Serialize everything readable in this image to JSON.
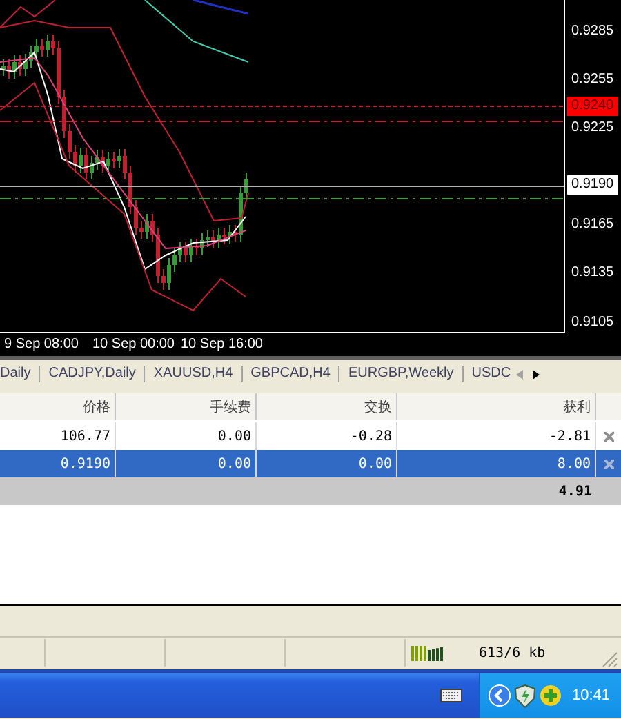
{
  "chart": {
    "price_labels": [
      "0.9285",
      "0.9255",
      "0.9225",
      "0.9165",
      "0.9135",
      "0.9105"
    ],
    "price_tags": [
      {
        "text": "0.9240",
        "kind": "alert"
      },
      {
        "text": "0.9190",
        "kind": "bid"
      }
    ],
    "time_labels": [
      "9 Sep 08:00",
      "10 Sep 00:00",
      "10 Sep 16:00"
    ]
  },
  "chart_tabs": [
    "Daily",
    "CADJPY,Daily",
    "XAUUSD,H4",
    "GBPCAD,H4",
    "EURGBP,Weekly",
    "USDC"
  ],
  "table": {
    "columns": [
      "价格",
      "手续费",
      "交换",
      "获利"
    ],
    "rows": [
      {
        "cells": [
          "106.77",
          "0.00",
          "-0.28",
          "-2.81"
        ],
        "selected": false
      },
      {
        "cells": [
          "0.9190",
          "0.00",
          "0.00",
          "8.00"
        ],
        "selected": true
      }
    ],
    "total": "4.91"
  },
  "status_bar": {
    "traffic": "613/6 kb"
  },
  "taskbar": {
    "clock": "10:41"
  }
}
